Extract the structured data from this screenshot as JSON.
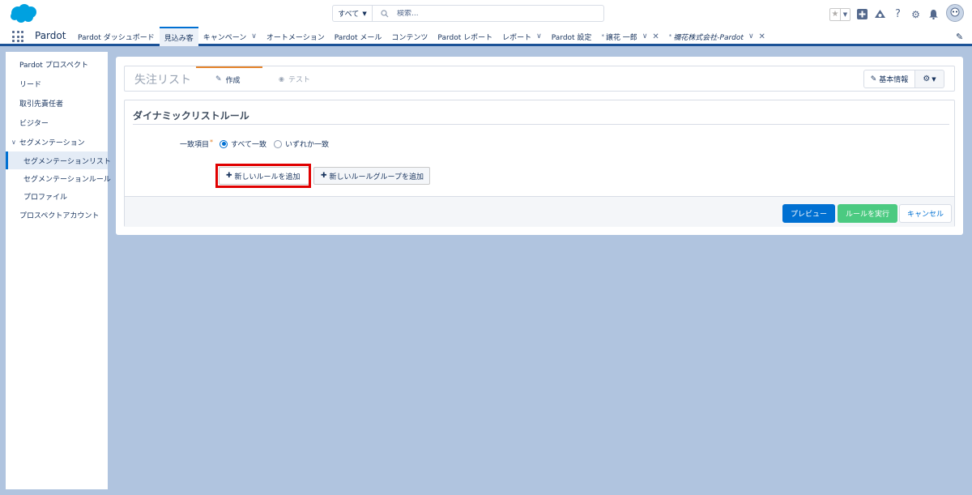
{
  "header": {
    "search_scope": "すべて",
    "search_placeholder": "検索..."
  },
  "nav": {
    "app_name": "Pardot",
    "items": [
      {
        "label": "Pardot ダッシュボード"
      },
      {
        "label": "見込み客"
      },
      {
        "label": "キャンペーン"
      },
      {
        "label": "オートメーション"
      },
      {
        "label": "Pardot メール"
      },
      {
        "label": "コンテンツ"
      },
      {
        "label": "Pardot レポート"
      },
      {
        "label": "レポート"
      },
      {
        "label": "Pardot 設定"
      },
      {
        "label": "譲花 一郎"
      },
      {
        "label": "禰花株式会社-Pardot"
      }
    ]
  },
  "sidebar": {
    "items": [
      {
        "label": "Pardot プロスペクト"
      },
      {
        "label": "リード"
      },
      {
        "label": "取引先責任者"
      },
      {
        "label": "ビジター"
      },
      {
        "label": "セグメンテーション"
      },
      {
        "label": "セグメンテーションリスト"
      },
      {
        "label": "セグメンテーションルール"
      },
      {
        "label": "プロファイル"
      },
      {
        "label": "プロスペクトアカウント"
      }
    ]
  },
  "page": {
    "title": "失注リスト",
    "tab_create": "作成",
    "tab_test": "テスト",
    "info_button": "基本情報"
  },
  "rules": {
    "section_title": "ダイナミックリストルール",
    "match_label": "一致項目",
    "option_all": "すべて一致",
    "option_any": "いずれか一致",
    "add_rule": "新しいルールを追加",
    "add_rule_group": "新しいルールグループを追加"
  },
  "footer": {
    "preview": "プレビュー",
    "run": "ルールを実行",
    "cancel": "キャンセル"
  },
  "colors": {
    "accent": "#0070d2",
    "run_green": "#4bca81",
    "highlight_red": "#e00000",
    "tab_orange": "#e4832a",
    "background": "#b0c4df"
  }
}
